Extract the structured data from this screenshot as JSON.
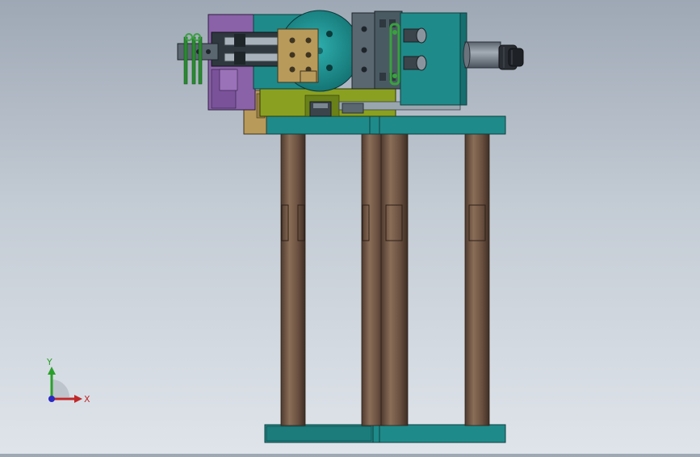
{
  "viewport": {
    "background_top": "#9ea8b5",
    "background_bottom": "#dfe4ea"
  },
  "model": {
    "colors": {
      "teal": "#1f8a8a",
      "teal_dark": "#176e6e",
      "column_brown": "#6a5040",
      "column_light": "#8a6e58",
      "purple": "#8a62a8",
      "olive": "#8aa020",
      "tan": "#b89a5a",
      "steel": "#4a5a62",
      "cylinder_gray": "#7a828c",
      "green": "#3aa040",
      "grey_block": "#5a6670"
    }
  },
  "triad": {
    "y_label": "Y",
    "x_label": "X",
    "y_color": "#2aa02a",
    "x_color": "#c0282a",
    "z_color": "#2a2ac0"
  }
}
